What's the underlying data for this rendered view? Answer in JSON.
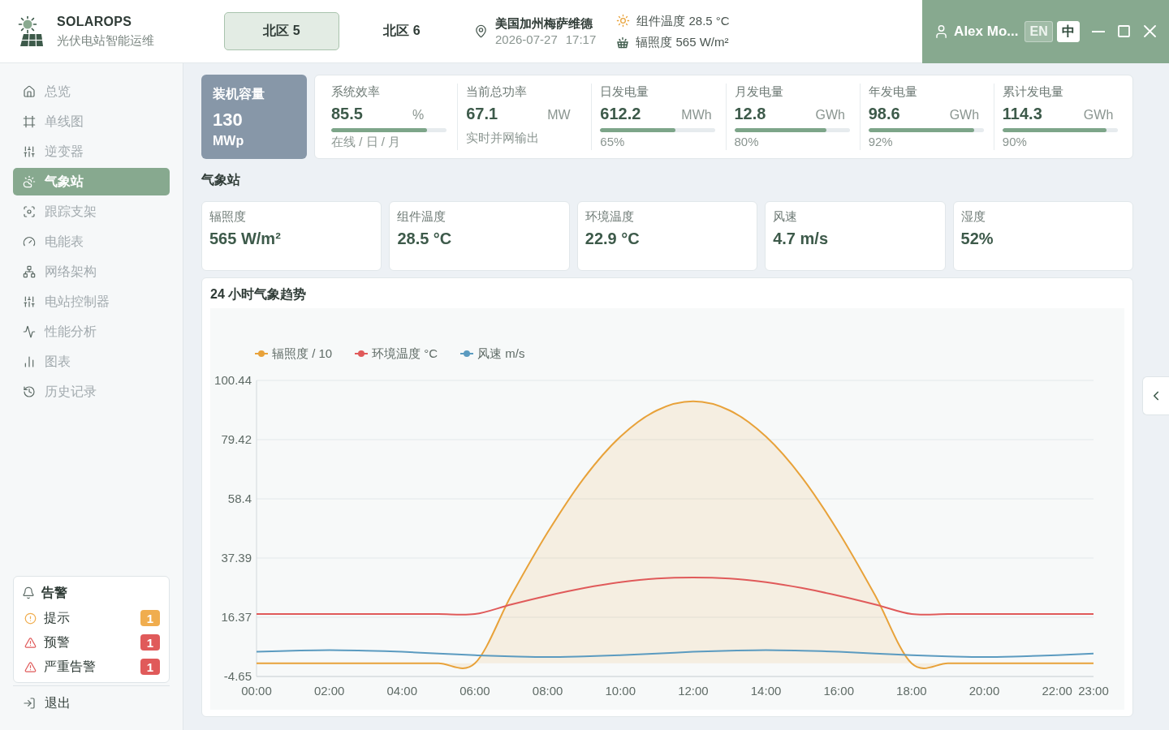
{
  "header": {
    "brand": {
      "name": "SOLAROPS",
      "tagline": "光伏电站智能运维"
    },
    "zones": [
      {
        "label": "北区 5",
        "selected": true
      },
      {
        "label": "北区 6",
        "selected": false
      }
    ],
    "location": {
      "name": "美国加州梅萨维德",
      "date": "2026-07-27",
      "time": "17:17"
    },
    "conditions": [
      {
        "kind": "sun",
        "text": "组件温度 28.5 °C"
      },
      {
        "kind": "panel",
        "text": "辐照度 565 W/m²"
      }
    ],
    "user": {
      "name": "Alex Mo...",
      "languages": [
        {
          "label": "EN",
          "selected": false
        },
        {
          "label": "中",
          "selected": true
        }
      ]
    }
  },
  "sidebar": {
    "items": [
      {
        "label": "总览",
        "selected": false
      },
      {
        "label": "单线图",
        "selected": false
      },
      {
        "label": "逆变器",
        "selected": false
      },
      {
        "label": "气象站",
        "selected": true
      },
      {
        "label": "跟踪支架",
        "selected": false
      },
      {
        "label": "电能表",
        "selected": false
      },
      {
        "label": "网络架构",
        "selected": false
      },
      {
        "label": "电站控制器",
        "selected": false
      },
      {
        "label": "性能分析",
        "selected": false
      },
      {
        "label": "图表",
        "selected": false
      },
      {
        "label": "历史记录",
        "selected": false
      }
    ],
    "alerts": {
      "title": "告警",
      "items": [
        {
          "kind": "info",
          "label": "提示",
          "count": "1",
          "color": "#f0ad4e"
        },
        {
          "kind": "warning",
          "label": "预警",
          "count": "1",
          "color": "#e05a5a"
        },
        {
          "kind": "critical",
          "label": "严重告警",
          "count": "1",
          "color": "#e05a5a"
        }
      ]
    },
    "logout": "退出"
  },
  "kpis": {
    "capacity": {
      "title": "装机容量",
      "value": "130",
      "unit": "MWp"
    },
    "metrics": [
      {
        "title": "系统效率",
        "value": "85.5",
        "unit": "%",
        "level": 0.83,
        "note": "在线 / 日 / 月"
      },
      {
        "title": "当前总功率",
        "value": "67.1",
        "unit": "MW",
        "note": "实时并网输出"
      },
      {
        "title": "日发电量",
        "value": "612.2",
        "unit": "MWh",
        "level": 0.65,
        "note": "65%"
      },
      {
        "title": "月发电量",
        "value": "12.8",
        "unit": "GWh",
        "level": 0.8,
        "note": "80%"
      },
      {
        "title": "年发电量",
        "value": "98.6",
        "unit": "GWh",
        "level": 0.92,
        "note": "92%"
      },
      {
        "title": "累计发电量",
        "value": "114.3",
        "unit": "GWh",
        "level": 0.9,
        "note": "90%"
      }
    ]
  },
  "weather": {
    "title": "气象站",
    "cards": [
      {
        "label": "辐照度",
        "value": "565 W/m²"
      },
      {
        "label": "组件温度",
        "value": "28.5 °C"
      },
      {
        "label": "环境温度",
        "value": "22.9 °C"
      },
      {
        "label": "风速",
        "value": "4.7 m/s"
      },
      {
        "label": "湿度",
        "value": "52%"
      }
    ]
  },
  "trend": {
    "title": "24 小时气象趋势",
    "chart_data": {
      "type": "line",
      "x": [
        0,
        1,
        2,
        3,
        4,
        5,
        6,
        7,
        8,
        9,
        10,
        11,
        12,
        13,
        14,
        15,
        16,
        17,
        18,
        19,
        20,
        21,
        22,
        23
      ],
      "series": [
        {
          "name": "辐照度 / 10",
          "type": "area",
          "color": "#e8a23a",
          "values": [
            0,
            0,
            0,
            0,
            0,
            0,
            0,
            24.1,
            46.5,
            65.8,
            80.5,
            89.8,
            93,
            89.8,
            80.5,
            65.8,
            46.5,
            24.1,
            0,
            0,
            0,
            0,
            0,
            0
          ]
        },
        {
          "name": "环境温度 °C",
          "color": "#e05a5a",
          "values": [
            17.5,
            17.5,
            17.5,
            17.5,
            17.5,
            17.5,
            17.5,
            20.9,
            24,
            26.7,
            28.8,
            30.1,
            30.5,
            30.1,
            28.8,
            26.7,
            24,
            20.9,
            17.5,
            17.5,
            17.5,
            17.5,
            17.5,
            17.5
          ]
        },
        {
          "name": "风速 m/s",
          "color": "#5b9bc0",
          "values": [
            4.1,
            4.5,
            4.7,
            4.5,
            4.1,
            3.5,
            2.9,
            2.5,
            2.3,
            2.5,
            2.9,
            3.5,
            4.1,
            4.5,
            4.7,
            4.5,
            4.1,
            3.5,
            2.9,
            2.5,
            2.3,
            2.5,
            2.9,
            3.5
          ]
        }
      ],
      "xlim": [
        0,
        23
      ],
      "ylim": [
        -4.65,
        100.44
      ],
      "yticks": [
        -4.65,
        16.37,
        37.39,
        58.4,
        79.42,
        100.44
      ],
      "xticks": [
        {
          "value": 0,
          "label": "00:00"
        },
        {
          "value": 2,
          "label": "02:00"
        },
        {
          "value": 4,
          "label": "04:00"
        },
        {
          "value": 6,
          "label": "06:00"
        },
        {
          "value": 8,
          "label": "08:00"
        },
        {
          "value": 10,
          "label": "10:00"
        },
        {
          "value": 12,
          "label": "12:00"
        },
        {
          "value": 14,
          "label": "14:00"
        },
        {
          "value": 16,
          "label": "16:00"
        },
        {
          "value": 18,
          "label": "18:00"
        },
        {
          "value": 20,
          "label": "20:00"
        },
        {
          "value": 22,
          "label": "22:00"
        },
        {
          "value": 23,
          "label": "23:00"
        }
      ],
      "grid": true,
      "legend": "top"
    }
  }
}
